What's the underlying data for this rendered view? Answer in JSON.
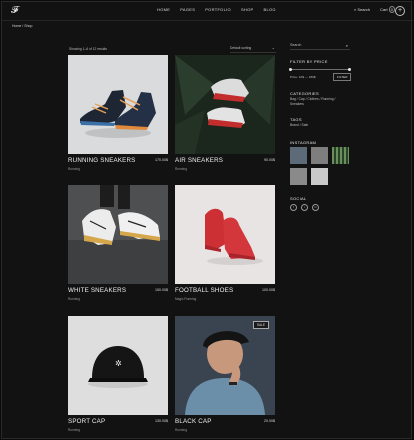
{
  "nav": {
    "items": [
      "HOME",
      "PAGES",
      "PORTFOLIO",
      "SHOP",
      "BLOG"
    ],
    "search_label": "Search",
    "cart_label": "Cart",
    "cart_count": "0"
  },
  "breadcrumb": "Home / Shop",
  "toolbar": {
    "showing": "Showing 1–6 of 12 results",
    "sort": "Default sorting"
  },
  "products": [
    {
      "name": "RUNNING SNEAKERS",
      "price": "170.00$",
      "category": "Running",
      "badge": ""
    },
    {
      "name": "AIR SNEAKERS",
      "price": "90.00$",
      "category": "Running",
      "badge": ""
    },
    {
      "name": "WHITE SNEAKERS",
      "price": "150.00$",
      "category": "Running",
      "badge": ""
    },
    {
      "name": "FOOTBALL SHOES",
      "price": "100.00$",
      "category": "Magic Running",
      "badge": ""
    },
    {
      "name": "SPORT CAP",
      "price": "130.00$",
      "category": "Running",
      "badge": ""
    },
    {
      "name": "BLACK CAP",
      "price": "20.00$",
      "category": "Running",
      "badge": "SALE"
    }
  ],
  "sidebar": {
    "search_placeholder": "Search",
    "filter_title": "FILTER BY PRICE",
    "price_range": "Price: 10$ — 180$",
    "filter_button": "FILTER",
    "categories_title": "CATEGORIES",
    "categories": "Bag / Cap / Clothes / Running / Sneakers",
    "tags_title": "TAGS",
    "tags": "Brand / Sale",
    "instagram_title": "INSTAGRAM",
    "social_title": "SOCIAL",
    "social": [
      "f",
      "t",
      "in"
    ]
  }
}
